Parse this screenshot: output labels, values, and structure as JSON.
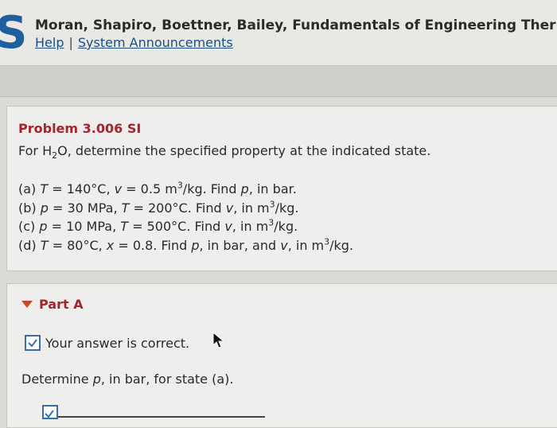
{
  "header": {
    "logo": "S",
    "book_title": "Moran, Shapiro, Boettner, Bailey, Fundamentals of Engineering Ther",
    "help_link": "Help",
    "separator": "|",
    "announcements_link": "System Announcements"
  },
  "problem": {
    "title": "Problem 3.006 SI",
    "statement_prefix": "For H",
    "statement_sub": "2",
    "statement_suffix": "O, determine the specified property at the indicated state.",
    "parts": [
      {
        "label": "(a) ",
        "var1": "T",
        "rest1": " = 140°C, ",
        "var2": "v",
        "rest2": " = 0.5 m",
        "sup": "3",
        "rest3": "/kg. Find ",
        "var3": "p",
        "rest4": ", in bar.",
        "var4": "",
        "rest5": ""
      },
      {
        "label": "(b) ",
        "var1": "p",
        "rest1": " = 30 MPa, ",
        "var2": "T",
        "rest2": " = 200°C. Find ",
        "sup": "",
        "rest3": "",
        "var3": "v",
        "rest4": ", in m",
        "var4": "3",
        "rest5": "/kg."
      },
      {
        "label": "(c) ",
        "var1": "p",
        "rest1": " = 10 MPa, ",
        "var2": "T",
        "rest2": " = 500°C. Find ",
        "sup": "",
        "rest3": "",
        "var3": "v",
        "rest4": ", in m",
        "var4": "3",
        "rest5": "/kg."
      },
      {
        "label": "(d) ",
        "var1": "T",
        "rest1": " = 80°C, ",
        "var2": "x",
        "rest2": " = 0.8. Find ",
        "sup": "",
        "rest3": "",
        "var3": "p",
        "rest4": ", in bar, and ",
        "var4": "v",
        "rest5": ", in m3/kg."
      }
    ]
  },
  "part_a": {
    "header": "Part A",
    "status": "Your answer is correct.",
    "question_prefix": "Determine ",
    "question_var": "p",
    "question_suffix": ", in bar, for state (a)."
  },
  "colors": {
    "accent_red": "#a3262e",
    "link_blue": "#1a4f86",
    "logo_blue": "#1e5f9e",
    "caret_orange": "#d2422a"
  }
}
